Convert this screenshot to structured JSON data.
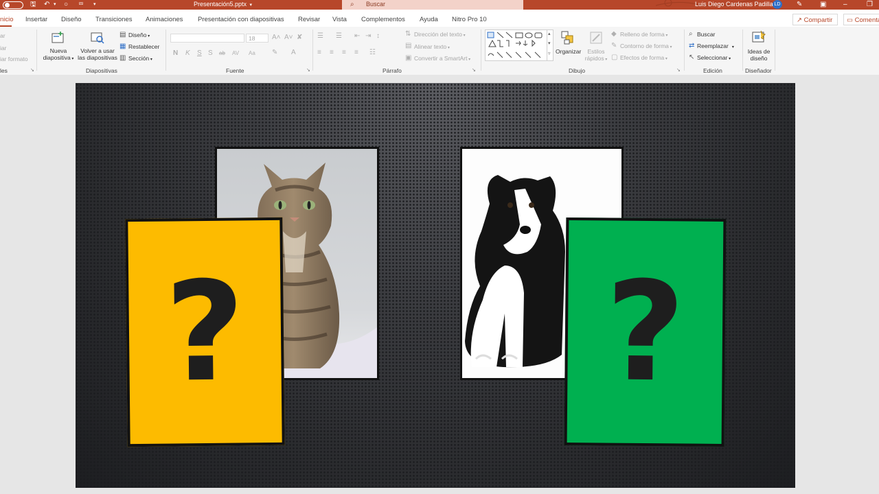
{
  "titlebar": {
    "doc_title": "Presentación5.pptx",
    "search_placeholder": "Buscar",
    "user_name": "Luis Diego Cardenas Padilla",
    "user_initials": "LD",
    "icons": [
      "toggle-icon",
      "save-icon",
      "undo-icon",
      "redo-icon",
      "customize-icon",
      "pen-icon",
      "ribbon-display-icon",
      "minimize-icon",
      "restore-icon"
    ]
  },
  "tabs": [
    "nicio",
    "Insertar",
    "Diseño",
    "Transiciones",
    "Animaciones",
    "Presentación con diapositivas",
    "Revisar",
    "Vista",
    "Complementos",
    "Ayuda",
    "Nitro Pro 10"
  ],
  "active_tab": "nicio",
  "share_label": "Compartir",
  "comment_label": "Comenta",
  "ribbon": {
    "clipboard": {
      "items": [
        "ar",
        "iar",
        "iar formato"
      ],
      "group_label": "les"
    },
    "slides": {
      "new_slide": [
        "Nueva",
        "diapositiva"
      ],
      "reuse": [
        "Volver a usar",
        "las diapositivas"
      ],
      "layout": "Diseño",
      "reset": "Restablecer",
      "section": "Sección",
      "group_label": "Diapositivas"
    },
    "font": {
      "size": "18",
      "buttons": [
        "N",
        "K",
        "S",
        "S",
        "ab",
        "AV",
        "Aa"
      ],
      "group_label": "Fuente"
    },
    "paragraph": {
      "text_direction": "Dirección del texto",
      "align_text": "Alinear texto",
      "smartart": "Convertir a SmartArt",
      "group_label": "Párrafo"
    },
    "drawing": {
      "arrange": "Organizar",
      "quick_styles": [
        "Estilos",
        "rápidos"
      ],
      "shape_fill": "Relleno de forma",
      "shape_outline": "Contorno de forma",
      "shape_effects": "Efectos de forma",
      "group_label": "Dibujo"
    },
    "editing": {
      "find": "Buscar",
      "replace": "Reemplazar",
      "select": "Seleccionar",
      "group_label": "Edición"
    },
    "designer": {
      "ideas": [
        "Ideas de",
        "diseño"
      ],
      "group_label": "Diseñador"
    }
  },
  "slide": {
    "cards": [
      {
        "name": "yellow-card",
        "color": "#fdbb00",
        "text": "?"
      },
      {
        "name": "green-card",
        "color": "#00b050",
        "text": "?"
      }
    ],
    "photos": [
      "cat-photo",
      "dog-photo"
    ]
  },
  "colors": {
    "accent": "#b7472a",
    "slide_bg": "#2b2c30",
    "yellow": "#fdbb00",
    "green": "#00b050"
  }
}
